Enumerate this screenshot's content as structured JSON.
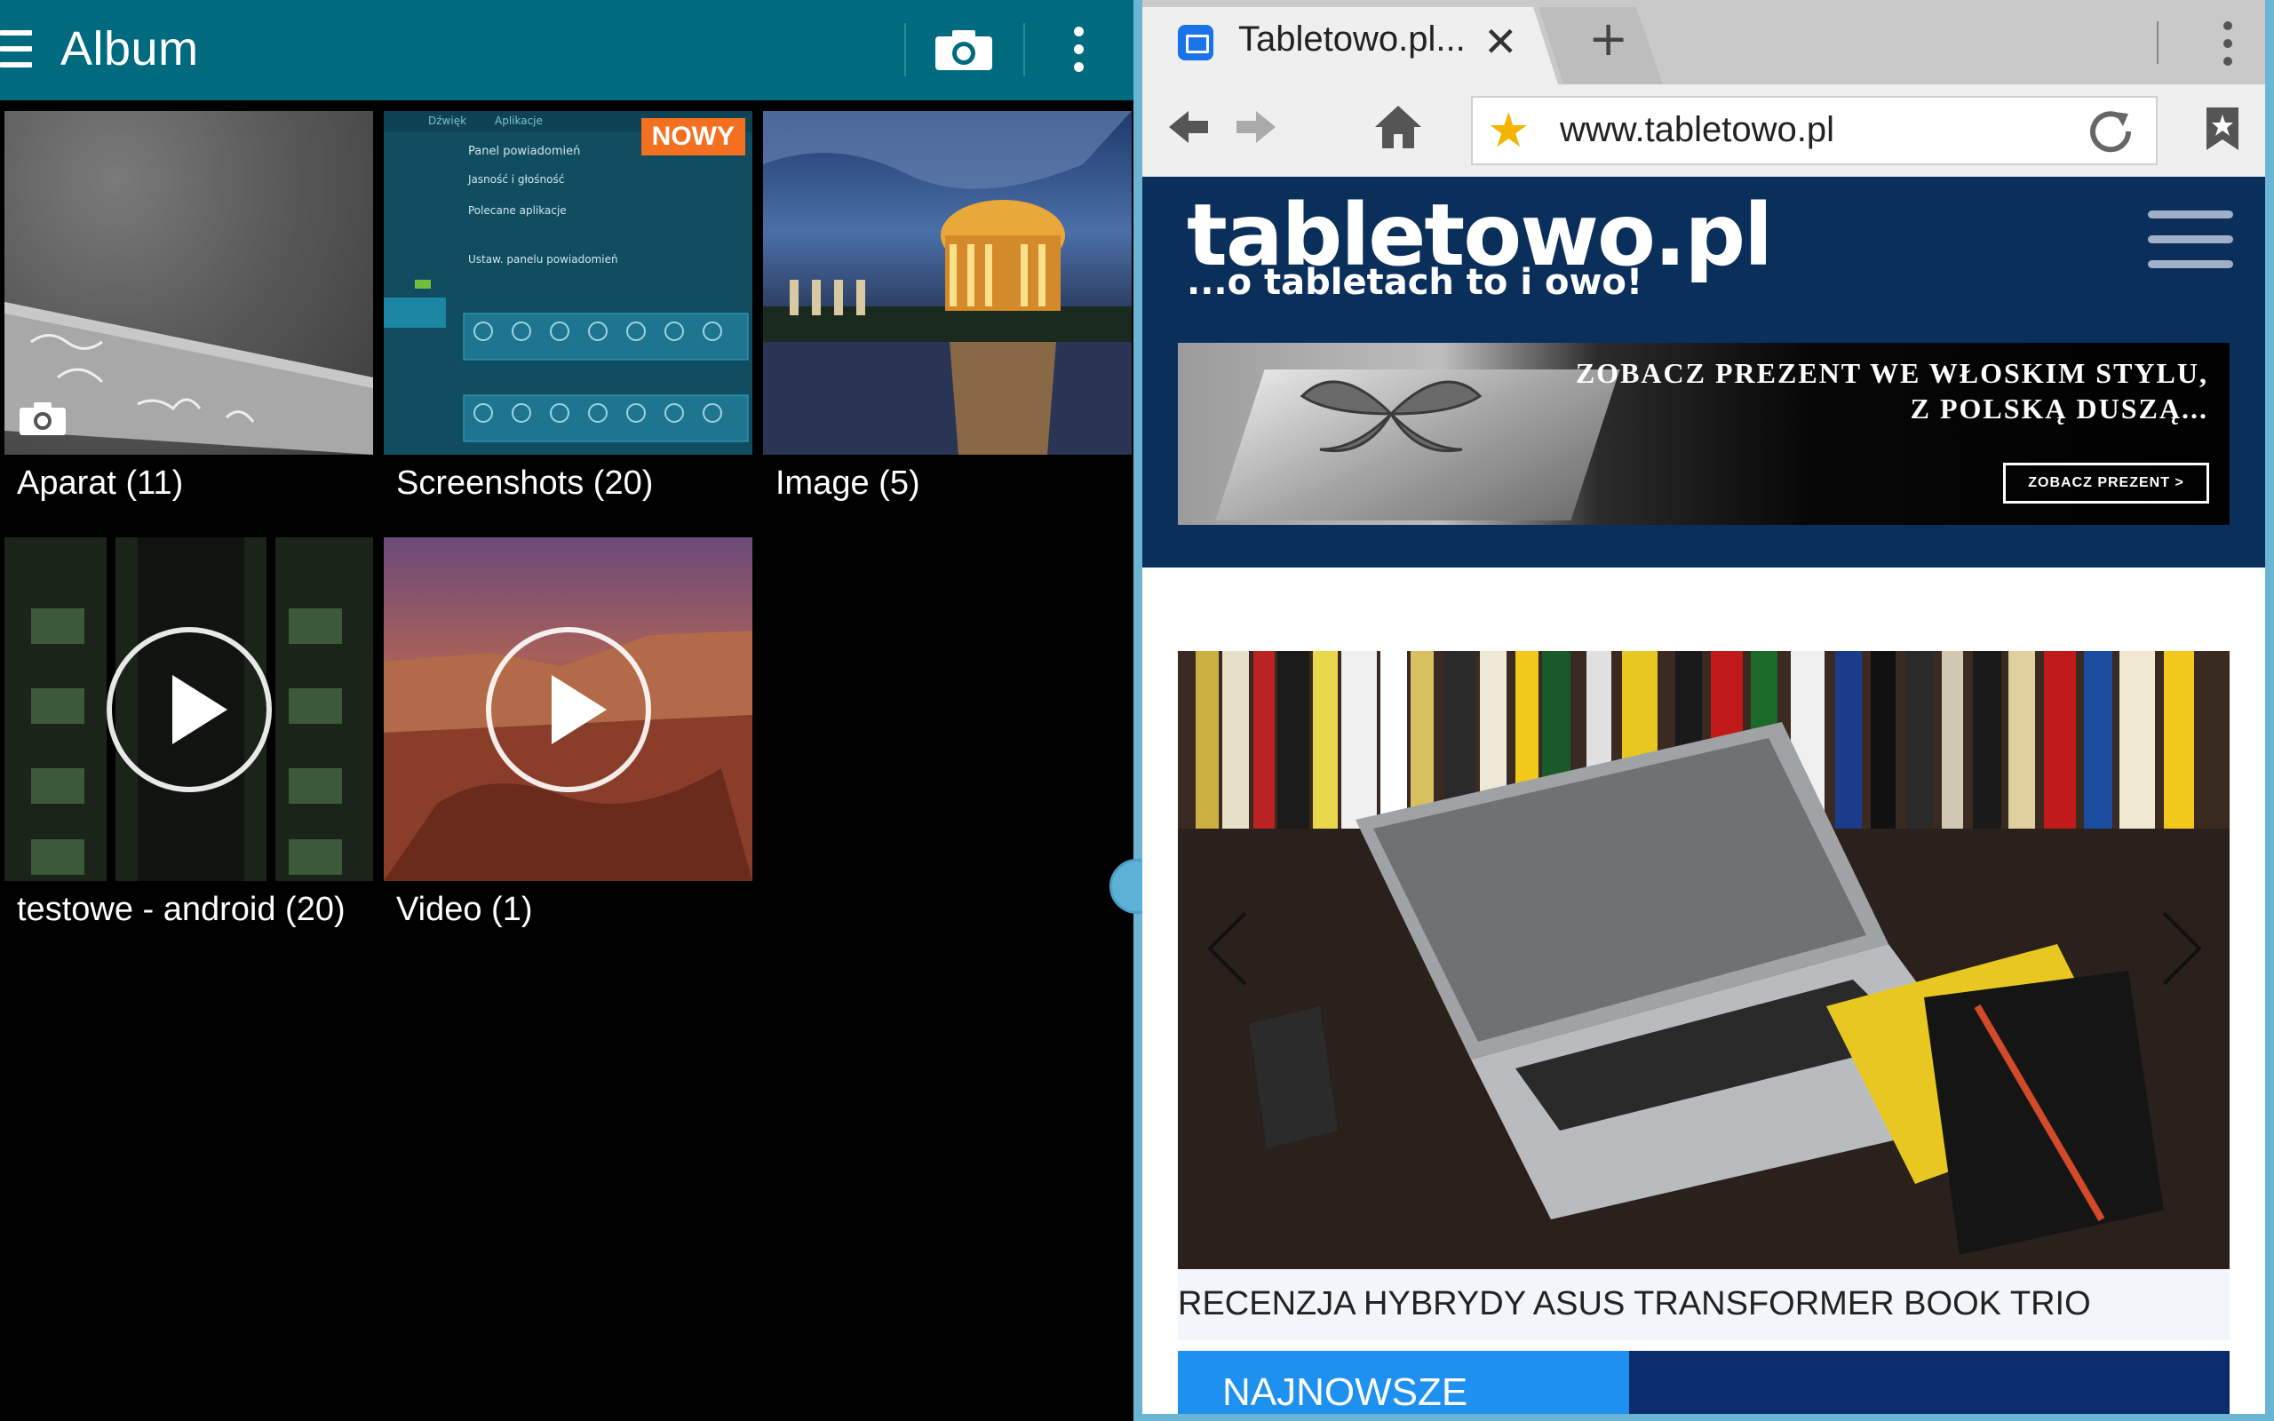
{
  "gallery": {
    "title": "Album",
    "albums": [
      {
        "label": "Aparat (11)",
        "type": "photo"
      },
      {
        "label": "Screenshots (20)",
        "badge": "NOWY"
      },
      {
        "label": "Image (5)"
      },
      {
        "label": "testowe - android (20)",
        "type": "video"
      },
      {
        "label": "Video (1)",
        "type": "video"
      }
    ],
    "screenshot_thumb_lines": [
      "Panel powiadomień",
      "Jasność i głośność",
      "Polecane aplikacje",
      "Ustaw. panelu powiadomień"
    ],
    "screenshot_thumb_tabs": [
      "Dźwięk",
      "Aplikacje"
    ]
  },
  "browser": {
    "tab_title": "Tabletowo.pl...",
    "url": "www.tabletowo.pl",
    "site": {
      "logo": "tabletowo.pl",
      "tagline": "...o tabletach to i owo!",
      "banner_line1": "ZOBACZ PREZENT WE WŁOSKIM STYLU,",
      "banner_line2": "Z POLSKĄ DUSZĄ...",
      "banner_button": "ZOBACZ PREZENT  >",
      "slide_caption": "RECENZJA HYBRYDY ASUS TRANSFORMER BOOK TRIO",
      "section_label": "NAJNOWSZE"
    }
  },
  "colors": {
    "gallery_bar": "#006a7f",
    "site_header": "#0b2f5b",
    "badge": "#f37021",
    "newest_tab": "#1e90f0",
    "divider": "#6ab4d4"
  }
}
